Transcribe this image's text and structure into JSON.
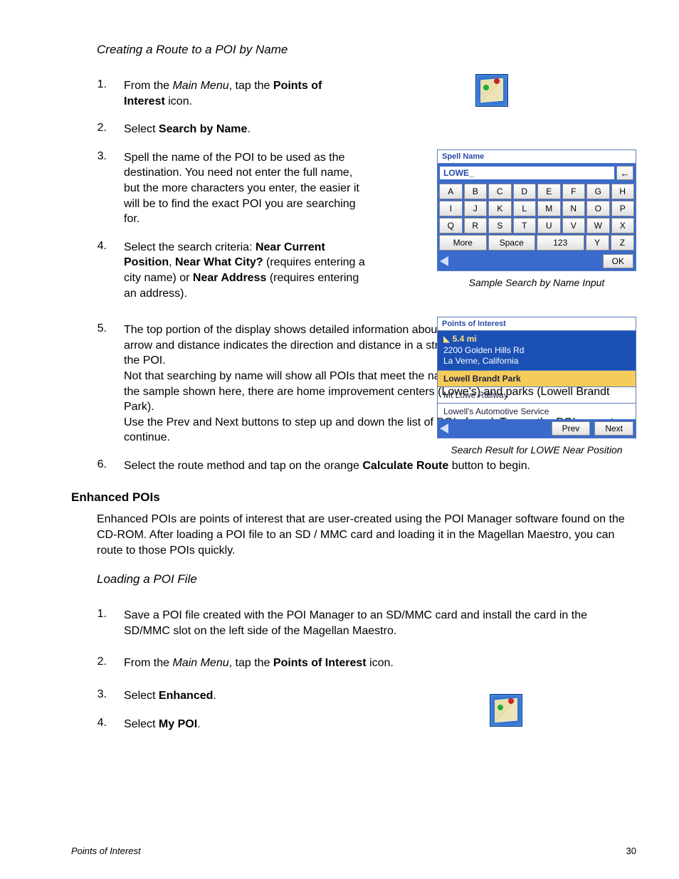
{
  "section1_title": "Creating a Route to a POI by Name",
  "steps1": {
    "1": {
      "pre": "From the ",
      "main_menu": "Main Menu",
      "mid": ", tap the ",
      "poi": "Points of Interest",
      "post": " icon."
    },
    "2": {
      "pre": "Select ",
      "sbn": "Search by Name",
      "post": "."
    },
    "3": "Spell the name of the POI to be used as the destination.  You need not enter the full name, but the more characters you enter, the easier it will be to find the exact POI you are searching for.",
    "4": {
      "pre": "Select the search criteria: ",
      "ncp": "Near Current Position",
      "sep1": ", ",
      "nwc": "Near What City?",
      "mid": " (requires entering a city name) or ",
      "na": "Near Address",
      "post": " (requires entering an address)."
    },
    "5a": "The top portion of the display shows detailed information about the highlighted POI in the list.  The arrow and distance indicates the direction and distance in a straight line from your current position to the POI.",
    "5b": "Not that searching by name will show all POIs that meet the name criteria, regardless of category.  In the sample shown here, there are home improvement centers (Lowe's) and parks (Lowell Brandt Park).",
    "5c": "Use the Prev and Next buttons to step up and down the list of POIs found.  Tap on the POI name to continue.",
    "6": {
      "pre": "Select the route method and tap on the orange ",
      "cr": "Calculate Route",
      "post": " button to begin."
    }
  },
  "subhead_enhanced": "Enhanced POIs",
  "enhanced_body": "Enhanced POIs are points of interest that are user-created using the POI Manager software found on the CD-ROM.  After loading a POI file to an SD / MMC card and loading it in the Magellan Maestro, you can route to those POIs quickly.",
  "section2_title": "Loading a POI File",
  "steps2": {
    "1": "Save a POI file created with the POI Manager to an SD/MMC card and install the card in the SD/MMC slot on the left side of the Magellan Maestro.",
    "2": {
      "pre": "From the ",
      "main_menu": "Main Menu",
      "mid": ", tap the ",
      "poi": "Points of Interest",
      "post": " icon."
    },
    "3": {
      "pre": "Select ",
      "enh": "Enhanced",
      "post": "."
    },
    "4": {
      "pre": "Select ",
      "mp": "My POI",
      "post": "."
    }
  },
  "kbd": {
    "title": "Spell Name",
    "value": "LOWE_",
    "row1": [
      "A",
      "B",
      "C",
      "D",
      "E",
      "F",
      "G",
      "H"
    ],
    "row2": [
      "I",
      "J",
      "K",
      "L",
      "M",
      "N",
      "O",
      "P"
    ],
    "row3": [
      "Q",
      "R",
      "S",
      "T",
      "U",
      "V",
      "W",
      "X"
    ],
    "row4": {
      "more": "More",
      "space": "Space",
      "num": "123",
      "y": "Y",
      "z": "Z"
    },
    "ok": "OK",
    "caption": "Sample Search by Name Input"
  },
  "res": {
    "title": "Points of Interest",
    "distance": "5.4 mi",
    "addr1": "2200 Golden Hills Rd",
    "addr2": "La Verne, California",
    "items": [
      "Lowell Brandt Park",
      "Mt Lowe Railway",
      "Lowell's Automotive Service"
    ],
    "prev": "Prev",
    "next": "Next",
    "caption": "Search Result for LOWE Near Position"
  },
  "footer": {
    "left": "Points of Interest",
    "page": "30"
  }
}
